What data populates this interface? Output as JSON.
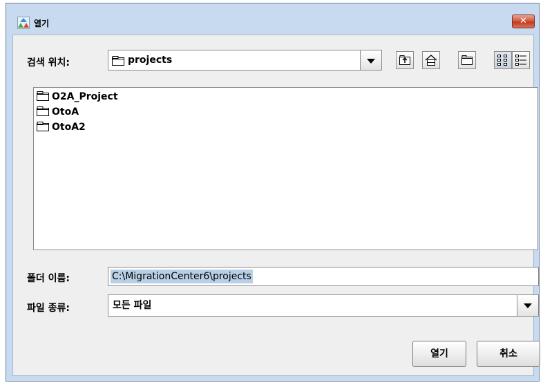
{
  "window": {
    "title": "열기",
    "icons": {
      "app": "java-cup-icon",
      "close": "close-icon"
    },
    "close_label": "✕"
  },
  "look_in": {
    "label": "검색 위치:",
    "value": "projects",
    "icons": [
      "folder-icon",
      "chevron-down-icon"
    ]
  },
  "toolbar": {
    "buttons": [
      {
        "name": "up-one-level-button",
        "icon": "up-folder-icon"
      },
      {
        "name": "home-button",
        "icon": "home-icon"
      },
      {
        "name": "new-folder-button",
        "icon": "new-folder-icon"
      },
      {
        "name": "list-view-button",
        "icon": "list-view-icon",
        "active": true
      },
      {
        "name": "details-view-button",
        "icon": "details-view-icon",
        "active": false
      }
    ]
  },
  "files": [
    {
      "name": "O2A_Project",
      "icon": "folder-icon"
    },
    {
      "name": "OtoA",
      "icon": "folder-icon"
    },
    {
      "name": "OtoA2",
      "icon": "folder-icon"
    }
  ],
  "folder_name": {
    "label": "폴더 이름:",
    "value": "C:\\MigrationCenter6\\projects"
  },
  "file_type": {
    "label": "파일 종류:",
    "value": "모든 파일"
  },
  "buttons": {
    "open": "열기",
    "cancel": "취소"
  },
  "colors": {
    "window_frame": "#c7daf0",
    "close_button": "#c8432a",
    "selection": "#b8cfe5",
    "content_bg": "#efefef"
  }
}
